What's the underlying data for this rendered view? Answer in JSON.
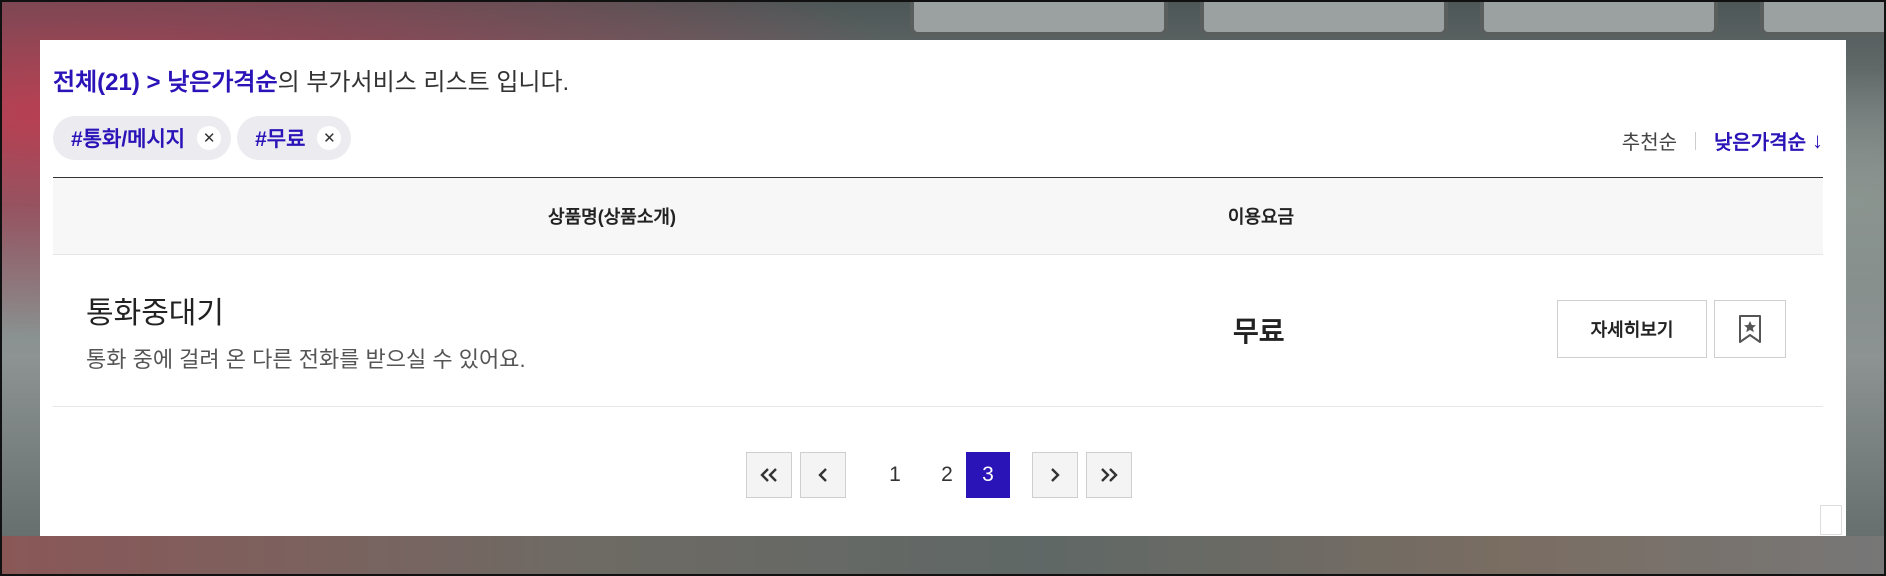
{
  "summary": {
    "filter_path": "전체(21) > 낮은가격순",
    "suffix": "의 부가서비스 리스트 입니다."
  },
  "chips": [
    {
      "label": "#통화/메시지",
      "remove_icon": "close-icon"
    },
    {
      "label": "#무료",
      "remove_icon": "close-icon"
    }
  ],
  "sort": {
    "options": [
      "추천순",
      "낮은가격순"
    ],
    "active": "낮은가격순",
    "direction_icon": "arrow-down-icon"
  },
  "table": {
    "headers": {
      "product": "상품명(상품소개)",
      "fee": "이용요금"
    },
    "rows": [
      {
        "name": "통화중대기",
        "description": "통화 중에 걸려 온 다른 전화를 받으실 수 있어요.",
        "price": "무료",
        "detail_label": "자세히보기",
        "bookmark_icon": "bookmark-star-icon"
      }
    ]
  },
  "pagination": {
    "first_icon": "double-chevron-left-icon",
    "prev_icon": "chevron-left-icon",
    "pages": [
      "1",
      "2",
      "3"
    ],
    "current": "3",
    "next_icon": "chevron-right-icon",
    "last_icon": "double-chevron-right-icon"
  },
  "colors": {
    "accent": "#2a14b8"
  }
}
